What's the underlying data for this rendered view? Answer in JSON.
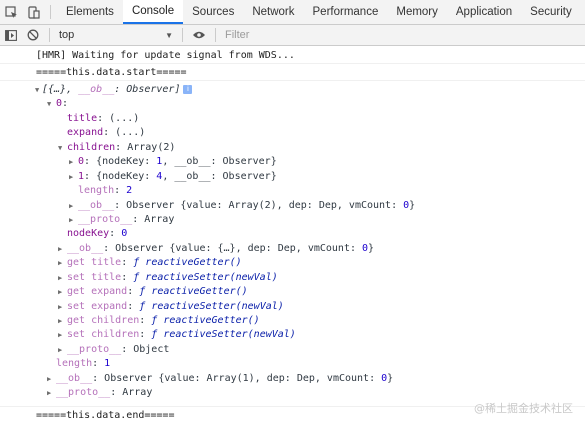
{
  "tabs": [
    "Elements",
    "Console",
    "Sources",
    "Network",
    "Performance",
    "Memory",
    "Application",
    "Security"
  ],
  "active_tab": "Console",
  "toolbar": {
    "context": "top",
    "filter_placeholder": "Filter"
  },
  "messages": {
    "hmr": "[HMR] Waiting for update signal from WDS...",
    "start": "=====this.data.start=====",
    "end": "=====this.data.end====="
  },
  "tree": {
    "root_summary_a": "[{…}, ",
    "root_summary_b": "__ob__",
    "root_summary_c": ": Observer]",
    "item0_key": "0",
    "title_key": "title",
    "title_val": "(...)",
    "expand_key": "expand",
    "expand_val": "(...)",
    "children_key": "children",
    "children_val": "Array(2)",
    "child0_key": "0",
    "child0_val_a": "{nodeKey: ",
    "child0_val_num": "1",
    "child0_val_b": ", __ob__: Observer}",
    "child1_key": "1",
    "child1_val_a": "{nodeKey: ",
    "child1_val_num": "4",
    "child1_val_b": ", __ob__: Observer}",
    "length2_key": "length",
    "length2_val": "2",
    "ob_children_key": "__ob__",
    "ob_children_val_a": "Observer {value: Array(2), dep: Dep, vmCount: ",
    "ob_children_val_num": "0",
    "ob_children_val_b": "}",
    "proto_children_key": "__proto__",
    "proto_children_val": "Array",
    "nodekey_key": "nodeKey",
    "nodekey_val": "0",
    "ob_item_key": "__ob__",
    "ob_item_val_a": "Observer {value: {…}, dep: Dep, vmCount: ",
    "ob_item_val_num": "0",
    "ob_item_val_b": "}",
    "get_title_key": "get title",
    "get_title_val": "reactiveGetter()",
    "set_title_key": "set title",
    "set_title_val": "reactiveSetter(newVal)",
    "get_expand_key": "get expand",
    "get_expand_val": "reactiveGetter()",
    "set_expand_key": "set expand",
    "set_expand_val": "reactiveSetter(newVal)",
    "get_children_key": "get children",
    "get_children_val": "reactiveGetter()",
    "set_children_key": "set children",
    "set_children_val": "reactiveSetter(newVal)",
    "proto_item_key": "__proto__",
    "proto_item_val": "Object",
    "length1_key": "length",
    "length1_val": "1",
    "ob_root_key": "__ob__",
    "ob_root_val_a": "Observer {value: Array(1), dep: Dep, vmCount: ",
    "ob_root_val_num": "0",
    "ob_root_val_b": "}",
    "proto_root_key": "__proto__",
    "proto_root_val": "Array",
    "f_glyph": "ƒ"
  },
  "watermark": "@稀土掘金技术社区",
  "colors": {
    "accent": "#1a73e8",
    "key": "#881391",
    "number": "#1c00cf",
    "function": "#0d22aa"
  }
}
